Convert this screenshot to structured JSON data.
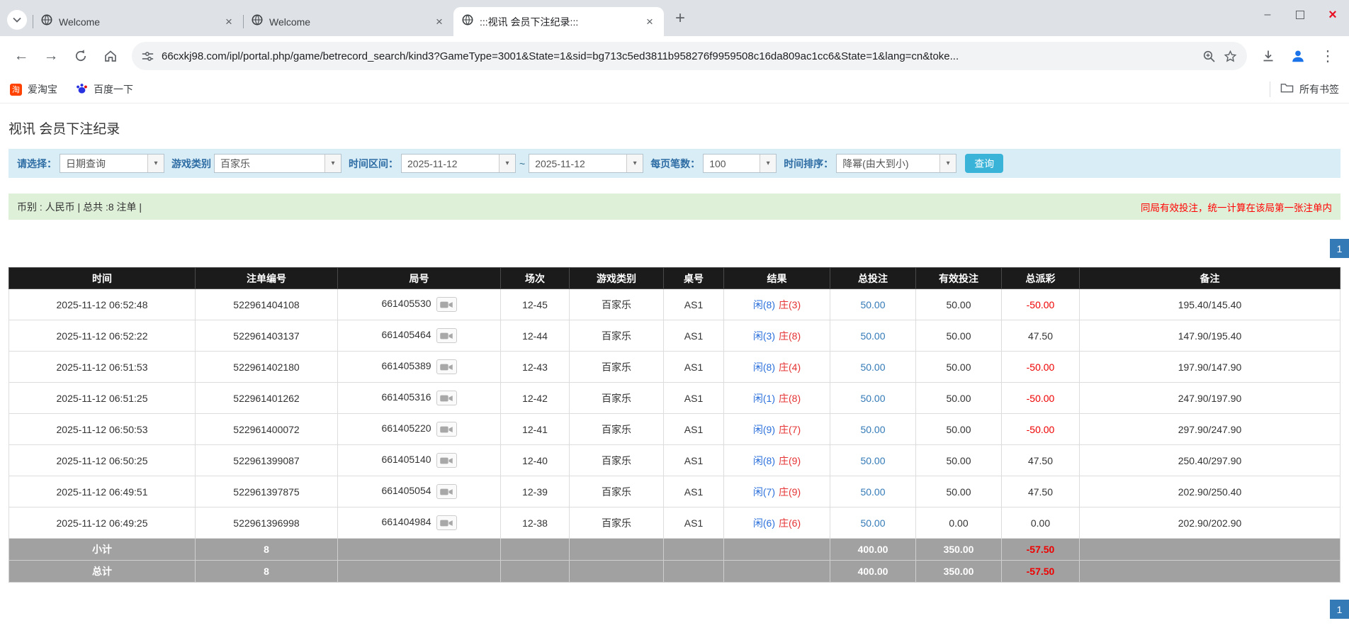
{
  "colors": {
    "accent_blue": "#337ab7",
    "player_blue": "#2a6fdb",
    "banker_red": "#e53333",
    "negative_red": "#ee0000",
    "filter_bar_bg": "#d9edf7",
    "summary_bar_bg": "#dff0d8",
    "search_button_bg": "#39b3d7",
    "table_header_bg": "#1b1b1b",
    "table_footer_bg": "#a1a1a1",
    "close_button_red": "#e81123"
  },
  "icons": {
    "tab_close": "×",
    "new_tab": "+",
    "minimize": "–",
    "close": "×",
    "back": "←",
    "forward": "→",
    "menu": "⋮",
    "caret": "▾",
    "tao_glyph": "淘"
  },
  "browser": {
    "tabs": [
      {
        "title": "Welcome"
      },
      {
        "title": "Welcome"
      },
      {
        "title": ":::视讯 会员下注纪录:::"
      }
    ],
    "url": "66cxkj98.com/ipl/portal.php/game/betrecord_search/kind3?GameType=3001&State=1&sid=bg713c5ed3811b958276f9959508c16da809ac1cc6&State=1&lang=cn&toke...",
    "bookmarks": {
      "item1": "爱淘宝",
      "item2": "百度一下",
      "all_bookmarks": "所有书签"
    }
  },
  "page": {
    "title": "视讯 会员下注纪录",
    "filters": {
      "select_label": "请选择：",
      "select_value": "日期查询",
      "game_type_label": "游戏类别",
      "game_type_value": "百家乐",
      "date_range_label": "时间区间：",
      "date_from": "2025-11-12",
      "date_separator": "~",
      "date_to": "2025-11-12",
      "page_size_label": "每页笔数：",
      "page_size_value": "100",
      "sort_label": "时间排序：",
      "sort_value": "降幂(由大到小)",
      "search_button": "查询"
    },
    "summary": {
      "left": "币别 : 人民币 | 总共 :8 注单 |",
      "right": "同局有效投注，统一计算在该局第一张注单内"
    },
    "pagination": "1",
    "table": {
      "headers": [
        "时间",
        "注单编号",
        "局号",
        "场次",
        "游戏类别",
        "桌号",
        "结果",
        "总投注",
        "有效投注",
        "总派彩",
        "备注"
      ],
      "rows": [
        {
          "time": "2025-11-12 06:52:48",
          "bet_id": "522961404108",
          "round": "661405530",
          "session": "12-45",
          "game": "百家乐",
          "table": "AS1",
          "result_player": "闲(8)",
          "result_banker": "庄(3)",
          "total_bet": "50.00",
          "valid_bet": "50.00",
          "payout": "-50.00",
          "note": "195.40/145.40"
        },
        {
          "time": "2025-11-12 06:52:22",
          "bet_id": "522961403137",
          "round": "661405464",
          "session": "12-44",
          "game": "百家乐",
          "table": "AS1",
          "result_player": "闲(3)",
          "result_banker": "庄(8)",
          "total_bet": "50.00",
          "valid_bet": "50.00",
          "payout": "47.50",
          "note": "147.90/195.40"
        },
        {
          "time": "2025-11-12 06:51:53",
          "bet_id": "522961402180",
          "round": "661405389",
          "session": "12-43",
          "game": "百家乐",
          "table": "AS1",
          "result_player": "闲(8)",
          "result_banker": "庄(4)",
          "total_bet": "50.00",
          "valid_bet": "50.00",
          "payout": "-50.00",
          "note": "197.90/147.90"
        },
        {
          "time": "2025-11-12 06:51:25",
          "bet_id": "522961401262",
          "round": "661405316",
          "session": "12-42",
          "game": "百家乐",
          "table": "AS1",
          "result_player": "闲(1)",
          "result_banker": "庄(8)",
          "total_bet": "50.00",
          "valid_bet": "50.00",
          "payout": "-50.00",
          "note": "247.90/197.90"
        },
        {
          "time": "2025-11-12 06:50:53",
          "bet_id": "522961400072",
          "round": "661405220",
          "session": "12-41",
          "game": "百家乐",
          "table": "AS1",
          "result_player": "闲(9)",
          "result_banker": "庄(7)",
          "total_bet": "50.00",
          "valid_bet": "50.00",
          "payout": "-50.00",
          "note": "297.90/247.90"
        },
        {
          "time": "2025-11-12 06:50:25",
          "bet_id": "522961399087",
          "round": "661405140",
          "session": "12-40",
          "game": "百家乐",
          "table": "AS1",
          "result_player": "闲(8)",
          "result_banker": "庄(9)",
          "total_bet": "50.00",
          "valid_bet": "50.00",
          "payout": "47.50",
          "note": "250.40/297.90"
        },
        {
          "time": "2025-11-12 06:49:51",
          "bet_id": "522961397875",
          "round": "661405054",
          "session": "12-39",
          "game": "百家乐",
          "table": "AS1",
          "result_player": "闲(7)",
          "result_banker": "庄(9)",
          "total_bet": "50.00",
          "valid_bet": "50.00",
          "payout": "47.50",
          "note": "202.90/250.40"
        },
        {
          "time": "2025-11-12 06:49:25",
          "bet_id": "522961396998",
          "round": "661404984",
          "session": "12-38",
          "game": "百家乐",
          "table": "AS1",
          "result_player": "闲(6)",
          "result_banker": "庄(6)",
          "total_bet": "50.00",
          "valid_bet": "0.00",
          "payout": "0.00",
          "note": "202.90/202.90"
        }
      ],
      "subtotal": {
        "label": "小计",
        "count": "8",
        "total_bet": "400.00",
        "valid_bet": "350.00",
        "payout": "-57.50"
      },
      "total": {
        "label": "总计",
        "count": "8",
        "total_bet": "400.00",
        "valid_bet": "350.00",
        "payout": "-57.50"
      }
    }
  }
}
